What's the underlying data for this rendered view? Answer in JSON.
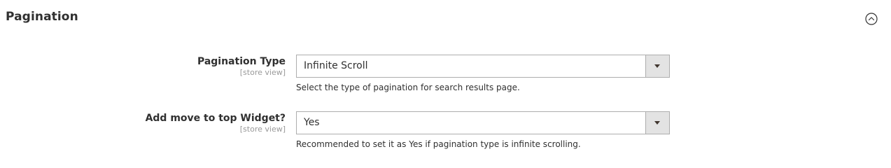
{
  "section": {
    "title": "Pagination",
    "toggle_icon": "chevron-up-circle-icon"
  },
  "fields": [
    {
      "label": "Pagination Type",
      "scope": "[store view]",
      "value": "Infinite Scroll",
      "note": "Select the type of pagination for search results page."
    },
    {
      "label": "Add move to top Widget?",
      "scope": "[store view]",
      "value": "Yes",
      "note": "Recommended to set it as Yes if pagination type is infinite scrolling."
    }
  ],
  "colors": {
    "text": "#303030",
    "scope_text": "#999999",
    "border": "#adadad",
    "arrow_bg": "#e3e3e3"
  }
}
